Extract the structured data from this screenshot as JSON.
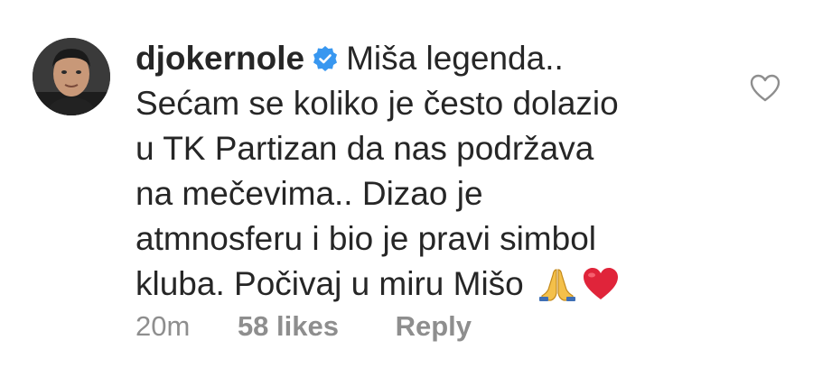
{
  "comment": {
    "username": "djokernole",
    "verified_icon": "verified-badge-icon",
    "lines": [
      "Miša legenda..",
      "Sećam se koliko je često dolazio",
      "u TK Partizan da nas podržava",
      "na mečevima.. Dizao je",
      "atmnosferu i bio je pravi simbol",
      "kluba. Počivaj u miru Mišo"
    ],
    "emojis": [
      "folded-hands-icon",
      "red-heart-icon"
    ],
    "like_icon": "heart-outline-icon"
  },
  "meta": {
    "time": "20m",
    "likes": "58 likes",
    "reply": "Reply"
  },
  "colors": {
    "text": "#262626",
    "muted": "#8e8e8e",
    "verified": "#3897f0",
    "heart": "#e0243a"
  }
}
